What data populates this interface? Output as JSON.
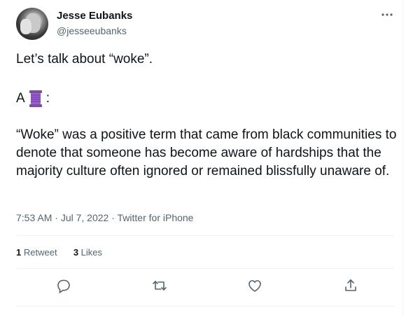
{
  "author": {
    "name": "Jesse Eubanks",
    "handle": "@jesseeubanks"
  },
  "menu_icon": "more-dots-icon",
  "tweet": {
    "line1": "Let’s talk about “woke”.",
    "line2_prefix": "A",
    "line2_emoji": "thread-spool-icon",
    "line2_suffix": ":",
    "body": "“Woke” was a positive term that came from black communities to denote that someone has become aware of hardships that the majority culture often ignored or remained blissfully unaware of."
  },
  "meta": {
    "time": "7:53 AM",
    "separator1": "·",
    "date": "Jul 7, 2022",
    "separator2": "·",
    "source": "Twitter for iPhone"
  },
  "stats": {
    "retweets_count": "1",
    "retweets_label": "Retweet",
    "likes_count": "3",
    "likes_label": "Likes"
  },
  "actions": [
    "reply-icon",
    "retweet-icon",
    "like-icon",
    "share-icon"
  ],
  "colors": {
    "text": "#0f1419",
    "secondary": "#536471",
    "divider": "#eff3f4"
  }
}
